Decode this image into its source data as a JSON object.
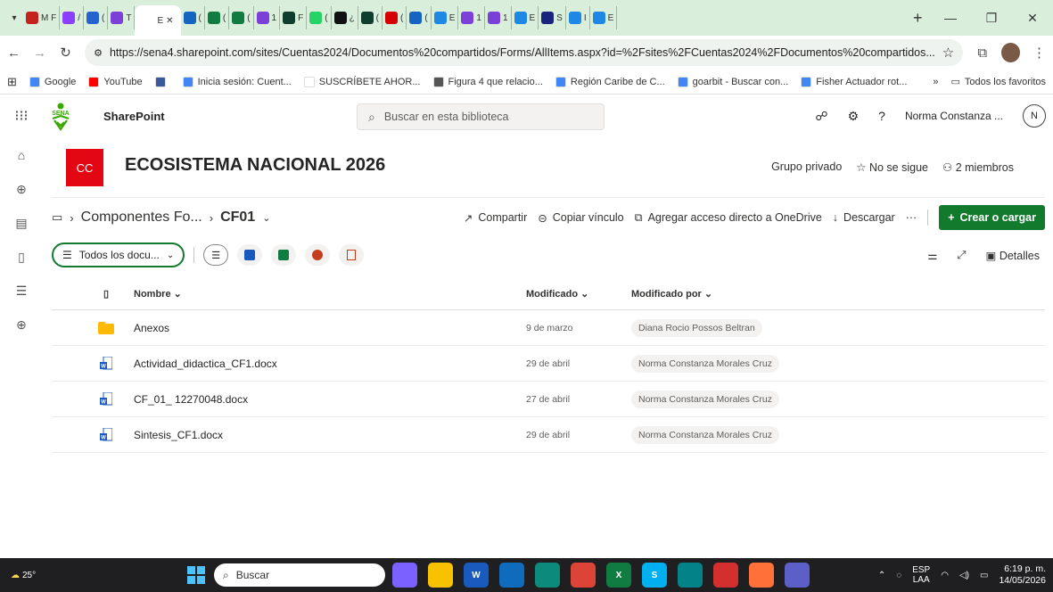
{
  "browser": {
    "tabs": [
      {
        "label": "M F",
        "color": "#c5221f"
      },
      {
        "label": "/",
        "color": "#8a3ffc"
      },
      {
        "label": "(",
        "color": "#2564cf"
      },
      {
        "label": "T",
        "color": "#7b40d8"
      },
      {
        "label": "E",
        "color": "#ffffff",
        "active": true
      },
      {
        "label": "(",
        "color": "#1565c0"
      },
      {
        "label": "(",
        "color": "#107c41"
      },
      {
        "label": "(",
        "color": "#107c41"
      },
      {
        "label": "1",
        "color": "#7b40d8"
      },
      {
        "label": "F",
        "color": "#0f3d2e"
      },
      {
        "label": "(",
        "color": "#25d366"
      },
      {
        "label": "¿",
        "color": "#111111"
      },
      {
        "label": "(",
        "color": "#0f3d2e"
      },
      {
        "label": "(",
        "color": "#d50000"
      },
      {
        "label": "(",
        "color": "#1565c0"
      },
      {
        "label": "E",
        "color": "#1e88e5"
      },
      {
        "label": "1",
        "color": "#7b40d8"
      },
      {
        "label": "1",
        "color": "#7b40d8"
      },
      {
        "label": "E",
        "color": "#1e88e5"
      },
      {
        "label": "S",
        "color": "#1a237e"
      },
      {
        "label": "I",
        "color": "#1e88e5"
      },
      {
        "label": "E",
        "color": "#1e88e5"
      }
    ],
    "new_tab": "+",
    "controls": {
      "minimize": "—",
      "restore": "❐",
      "close": "✕"
    },
    "url": "https://sena4.sharepoint.com/sites/Cuentas2024/Documentos%20compartidos/Forms/AllItems.aspx?id=%2Fsites%2FCuentas2024%2FDocumentos%20compartidos...",
    "bookmarks": [
      {
        "label": "Google",
        "color": "#4285f4"
      },
      {
        "label": "YouTube",
        "color": "#ff0000"
      },
      {
        "label": "",
        "color": "#3b5998"
      },
      {
        "label": "Inicia sesión: Cuent...",
        "color": "#4285f4"
      },
      {
        "label": "SUSCRÍBETE AHOR...",
        "color": "#ffffff"
      },
      {
        "label": "Figura 4 que relacio...",
        "color": "#555555"
      },
      {
        "label": "Región Caribe de C...",
        "color": "#4285f4"
      },
      {
        "label": "goarbit - Buscar con...",
        "color": "#4285f4"
      },
      {
        "label": "Fisher Actuador rot...",
        "color": "#4285f4"
      }
    ],
    "bookmarks_more": "»",
    "all_bookmarks": "Todos los favoritos"
  },
  "sharepoint": {
    "app_name": "SharePoint",
    "search_placeholder": "Buscar en esta biblioteca",
    "user_name": "Norma Constanza ...",
    "user_initial": "N"
  },
  "site": {
    "logo_text": "CC",
    "title": "ECOSISTEMA NACIONAL 2026",
    "privacy": "Grupo privado",
    "follow": "No se sigue",
    "members": "2 miembros"
  },
  "breadcrumb": {
    "parent": "Componentes Fo...",
    "current": "CF01"
  },
  "commands": {
    "share": "Compartir",
    "copy_link": "Copiar vínculo",
    "shortcut": "Agregar acceso directo a OneDrive",
    "download": "Descargar",
    "more": "···",
    "create": "Crear o cargar"
  },
  "view": {
    "name": "Todos los docu...",
    "details": "Detalles"
  },
  "list": {
    "headers": {
      "name": "Nombre",
      "modified": "Modificado",
      "modified_by": "Modificado por"
    },
    "rows": [
      {
        "type": "folder",
        "name": "Anexos",
        "modified": "9 de marzo",
        "modified_by": "Diana Rocio Possos Beltran"
      },
      {
        "type": "docx",
        "name": "Actividad_didactica_CF1.docx",
        "modified": "29 de abril",
        "modified_by": "Norma Constanza Morales Cruz"
      },
      {
        "type": "docx",
        "name": "CF_01_ 12270048.docx",
        "modified": "27 de abril",
        "modified_by": "Norma Constanza Morales Cruz"
      },
      {
        "type": "docx",
        "name": "Sintesis_CF1.docx",
        "modified": "29 de abril",
        "modified_by": "Norma Constanza Morales Cruz"
      }
    ]
  },
  "taskbar": {
    "temperature": "25°",
    "search": "Buscar",
    "lang_top": "ESP",
    "lang_bottom": "LAA",
    "time": "6:19 p. m.",
    "date": "14/05/2026"
  }
}
